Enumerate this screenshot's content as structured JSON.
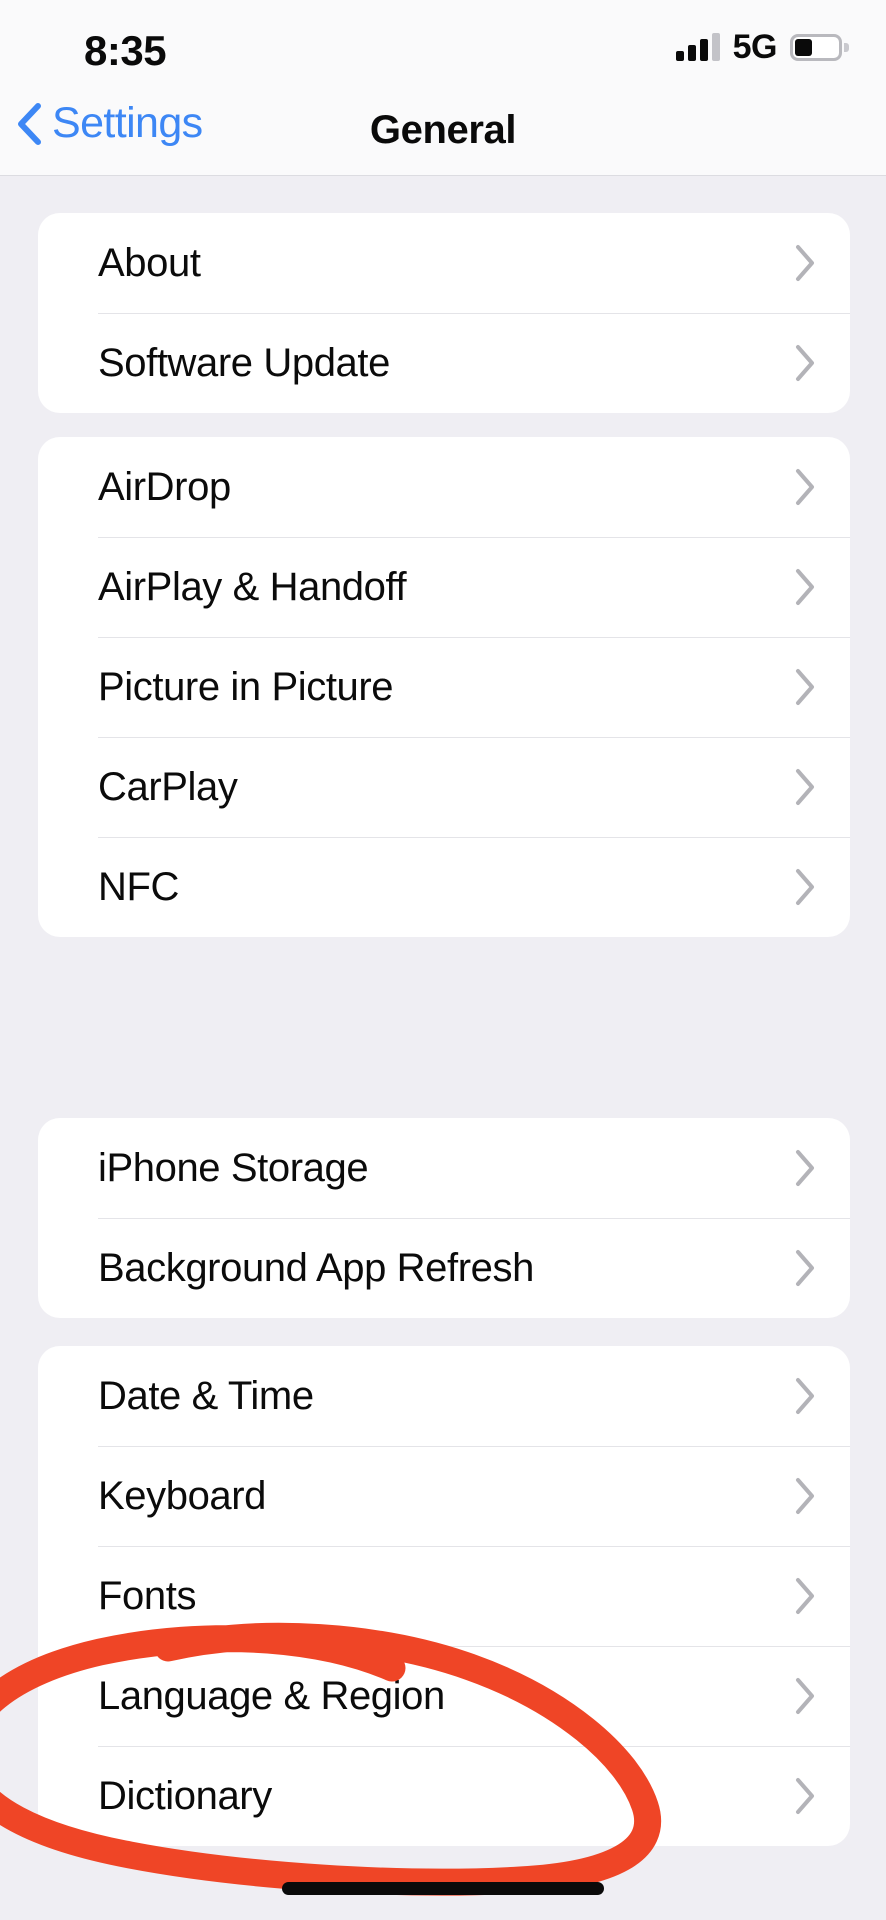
{
  "status_bar": {
    "time": "8:35",
    "network": "5G",
    "signal_icon": "cellular-signal-icon",
    "signal_bars_filled": 3,
    "signal_bars_total": 4,
    "battery_icon": "battery-icon",
    "battery_level_percent": 33
  },
  "nav": {
    "back_label": "Settings",
    "back_icon": "chevron-left-icon",
    "title": "General"
  },
  "colors": {
    "accent_blue": "#3d87f5",
    "annotation_red": "#ef4526",
    "page_background": "#efeef3",
    "card_background": "#ffffff",
    "separator": "#e4e4e8",
    "chevron_gray": "#b3b3b8"
  },
  "groups": [
    {
      "rows": [
        {
          "label": "About",
          "chevron_icon": "chevron-right-icon"
        },
        {
          "label": "Software Update",
          "chevron_icon": "chevron-right-icon"
        }
      ]
    },
    {
      "rows": [
        {
          "label": "AirDrop",
          "chevron_icon": "chevron-right-icon"
        },
        {
          "label": "AirPlay & Handoff",
          "chevron_icon": "chevron-right-icon"
        },
        {
          "label": "Picture in Picture",
          "chevron_icon": "chevron-right-icon"
        },
        {
          "label": "CarPlay",
          "chevron_icon": "chevron-right-icon"
        },
        {
          "label": "NFC",
          "chevron_icon": "chevron-right-icon"
        }
      ]
    },
    {
      "rows": [
        {
          "label": "iPhone Storage",
          "chevron_icon": "chevron-right-icon"
        },
        {
          "label": "Background App Refresh",
          "chevron_icon": "chevron-right-icon"
        }
      ]
    },
    {
      "rows": [
        {
          "label": "Date & Time",
          "chevron_icon": "chevron-right-icon"
        },
        {
          "label": "Keyboard",
          "chevron_icon": "chevron-right-icon"
        },
        {
          "label": "Fonts",
          "chevron_icon": "chevron-right-icon"
        },
        {
          "label": "Language & Region",
          "chevron_icon": "chevron-right-icon"
        },
        {
          "label": "Dictionary",
          "chevron_icon": "chevron-right-icon"
        }
      ]
    }
  ],
  "annotation": {
    "type": "hand-drawn-circle",
    "target_label": "Language & Region",
    "color": "#ef4526"
  },
  "home_indicator": {
    "icon": "home-indicator-bar"
  }
}
